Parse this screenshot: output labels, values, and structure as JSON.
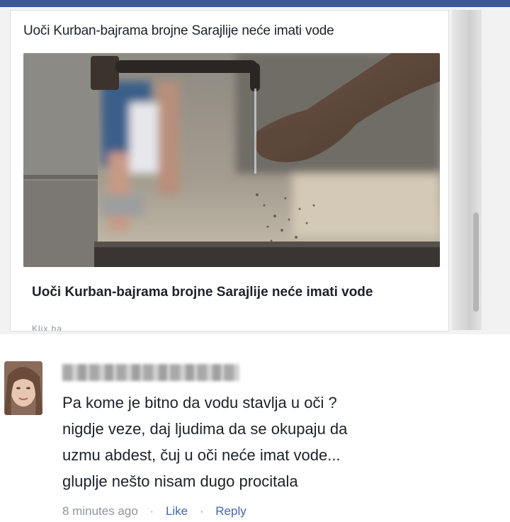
{
  "post": {
    "title": "Uoči Kurban-bajrama brojne Sarajlije neće imati vode",
    "link_title": "Uoči Kurban-bajrama brojne Sarajlije neće imati vode",
    "link_source": "Klix.ba"
  },
  "comment": {
    "lines": [
      "Pa kome je bitno da vodu stavlja u oči ?",
      "nigdje veze, daj ljudima da se okupaju da",
      "uzmu abdest, čuj u oči neće imat vode...",
      "gluplje nešto nisam dugo procitala"
    ],
    "time": "8 minutes ago",
    "like_label": "Like",
    "reply_label": "Reply",
    "separator": "·"
  },
  "colors": {
    "facebook_blue": "#3b5998",
    "link_blue": "#4267b2",
    "meta_gray": "#90949c",
    "text_dark": "#1d2129"
  }
}
